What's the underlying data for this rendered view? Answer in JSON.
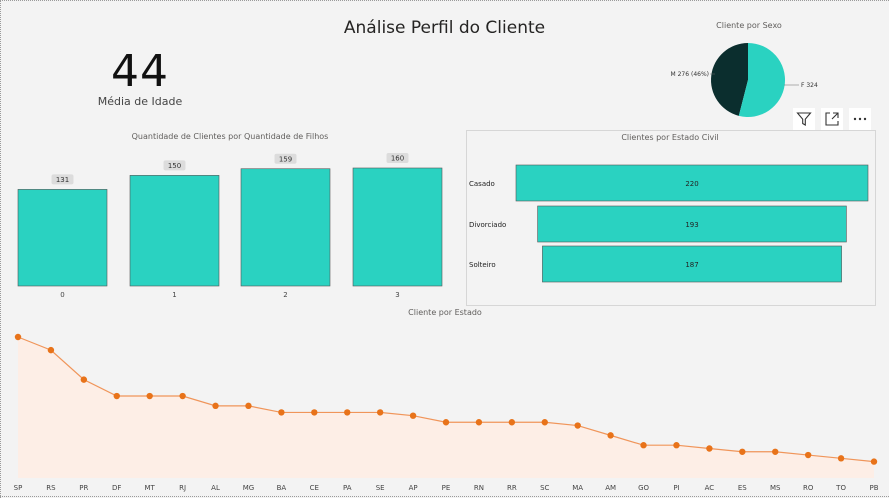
{
  "page": {
    "title": "Análise Perfil do Cliente"
  },
  "kpi": {
    "value": "44",
    "label": "Média de Idade"
  },
  "pie": {
    "title": "Cliente por Sexo",
    "slices": [
      {
        "label": "M 276 (46%)",
        "value": 276,
        "color": "#0b2e2e"
      },
      {
        "label": "F 324 (54%)",
        "value": 324,
        "color": "#2ad2c1"
      }
    ]
  },
  "children_chart": {
    "title": "Quantidade de Clientes por Quantidade de Filhos"
  },
  "civil_chart": {
    "title": "Clientes por Estado Civil"
  },
  "state_chart": {
    "title": "Cliente por Estado"
  },
  "toolbar": {
    "filter_icon": "filter-icon",
    "focus_icon": "focus-mode-icon",
    "more_icon": "more-options-icon"
  },
  "colors": {
    "teal": "#2ad2c1",
    "dark": "#0b2e2e",
    "orange": "#e8731a",
    "orange_fill": "#fdeee6"
  },
  "chart_data": [
    {
      "type": "bar",
      "title": "Quantidade de Clientes por Quantidade de Filhos",
      "categories": [
        "0",
        "1",
        "2",
        "3"
      ],
      "values": [
        131,
        150,
        159,
        160
      ],
      "ylim": [
        0,
        170
      ]
    },
    {
      "type": "bar",
      "orientation": "horizontal",
      "title": "Clientes por Estado Civil",
      "categories": [
        "Casado",
        "Divorciado",
        "Solteiro"
      ],
      "values": [
        220,
        193,
        187
      ]
    },
    {
      "type": "pie",
      "title": "Cliente por Sexo",
      "categories": [
        "M",
        "F"
      ],
      "values": [
        276,
        324
      ],
      "labels": [
        "M 276 (46%)",
        "F 324 (54%)"
      ]
    },
    {
      "type": "area",
      "title": "Cliente por Estado",
      "categories": [
        "SP",
        "RS",
        "PR",
        "DF",
        "MT",
        "RJ",
        "AL",
        "MG",
        "BA",
        "CE",
        "PA",
        "SE",
        "AP",
        "PE",
        "RN",
        "RR",
        "SC",
        "MA",
        "AM",
        "GO",
        "PI",
        "AC",
        "ES",
        "MS",
        "RO",
        "TO",
        "PB"
      ],
      "values": [
        43,
        39,
        30,
        25,
        25,
        25,
        22,
        22,
        20,
        20,
        20,
        20,
        19,
        17,
        17,
        17,
        17,
        16,
        13,
        10,
        10,
        9,
        8,
        8,
        7,
        6,
        5
      ],
      "ylim": [
        0,
        45
      ]
    }
  ]
}
